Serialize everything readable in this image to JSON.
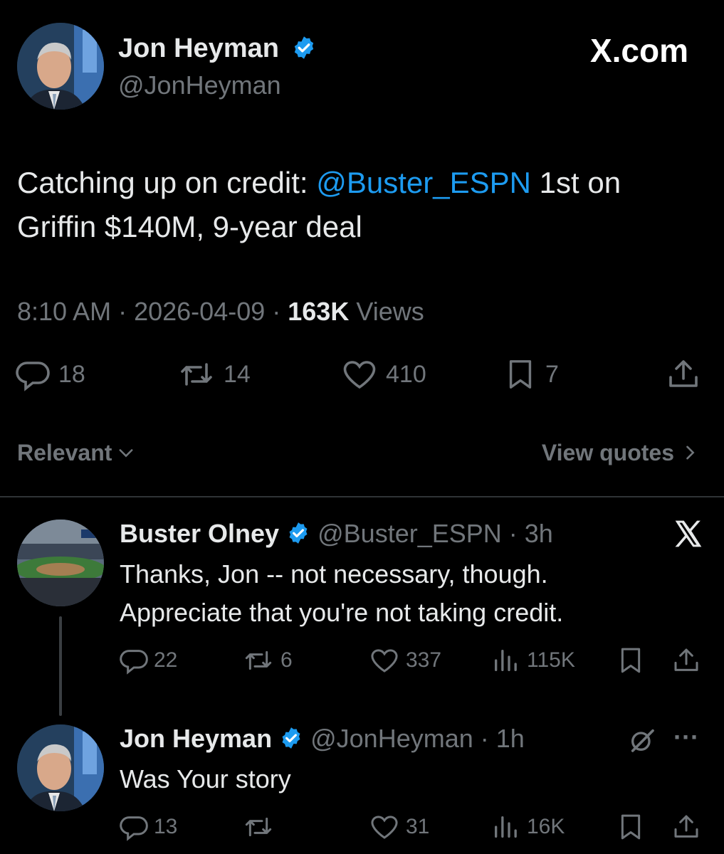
{
  "header": {
    "logo_text": "X.com",
    "author": {
      "name": "Jon Heyman",
      "handle": "@JonHeyman"
    }
  },
  "main_tweet": {
    "text_before": "Catching up on credit: ",
    "mention": "@Buster_ESPN",
    "text_after_line1": " 1st on",
    "text_line2": "Griffin $140M, 9-year deal",
    "time": "8:10 AM",
    "sep": " · ",
    "date": "2026-04-09",
    "views_count": "163K",
    "views_label": "Views",
    "stats": {
      "replies": "18",
      "reposts": "14",
      "likes": "410",
      "bookmarks": "7"
    }
  },
  "filters": {
    "sort_label": "Relevant",
    "quotes_label": "View quotes"
  },
  "reply1": {
    "name": "Buster Olney",
    "handle": "@Buster_ESPN",
    "time": "3h",
    "line1": "Thanks, Jon -- not necessary, though.",
    "line2": "Appreciate that you're not taking credit.",
    "stats": {
      "replies": "22",
      "reposts": "6",
      "likes": "337",
      "views": "115K"
    }
  },
  "reply2": {
    "name": "Jon Heyman",
    "handle": "@JonHeyman",
    "time": "1h",
    "text": "Was Your story",
    "more": "···",
    "stats": {
      "replies": "13",
      "likes": "31",
      "views": "16K"
    }
  },
  "colors": {
    "accent": "#1d9bf0",
    "muted": "#71767b",
    "text": "#e7e9ea",
    "background": "#000000"
  }
}
